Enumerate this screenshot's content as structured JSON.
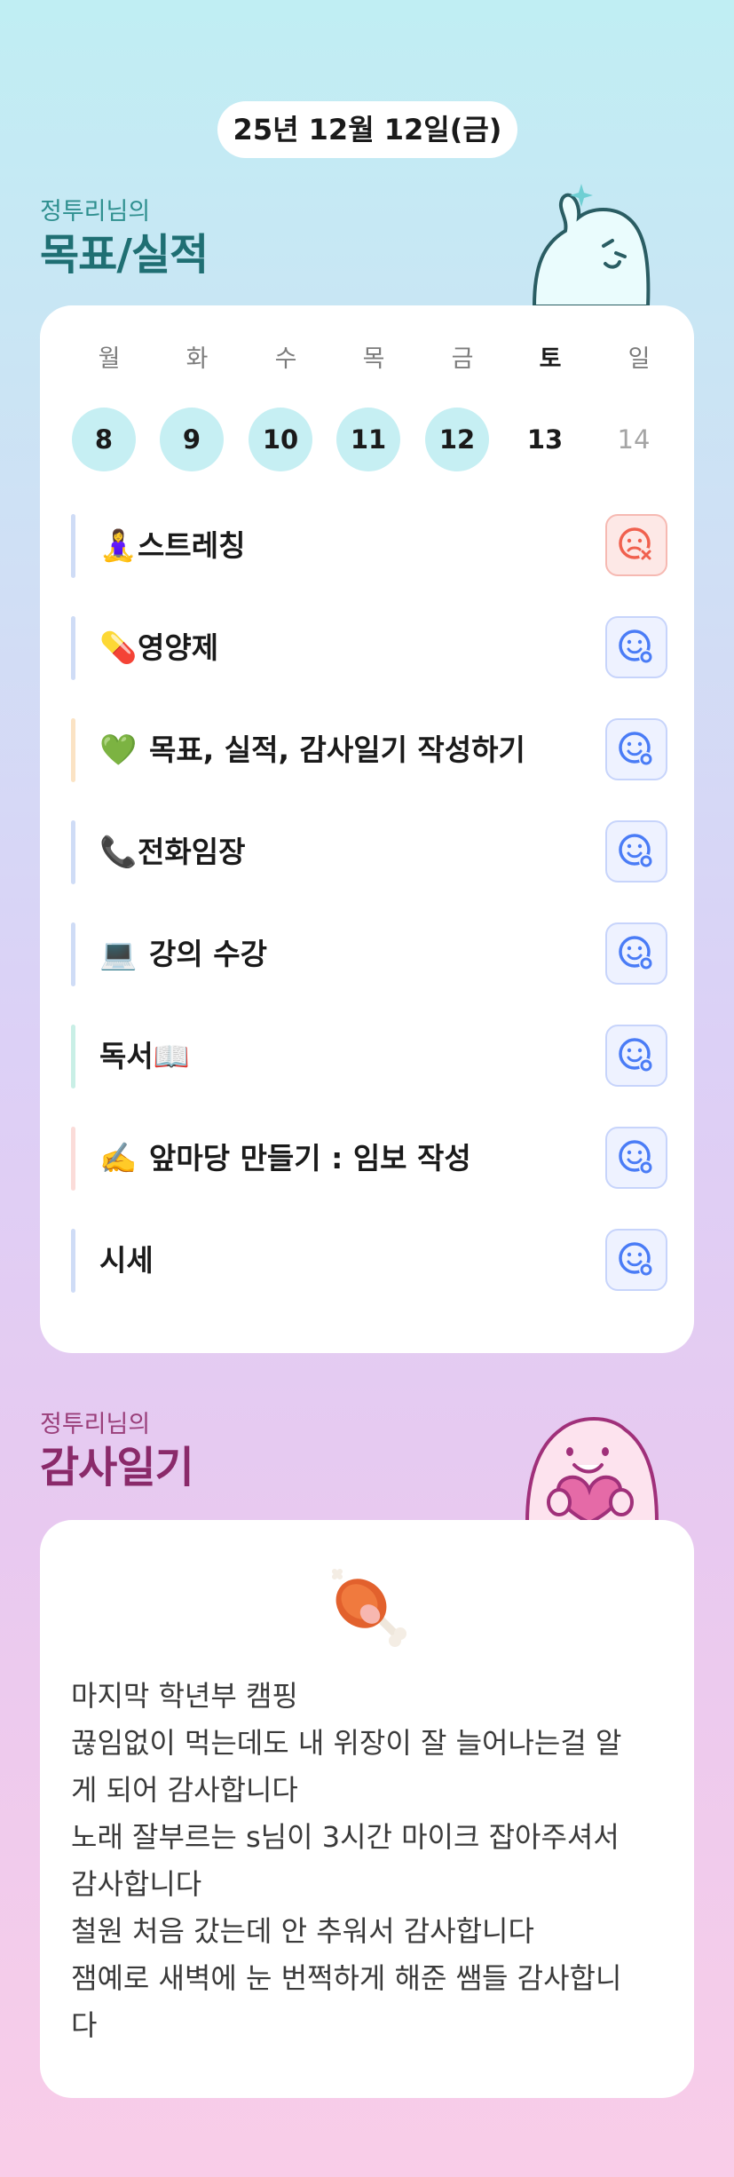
{
  "date": "25년 12월 12일(금)",
  "goals_section": {
    "subtitle": "정투리님의",
    "title": "목표/실적"
  },
  "week": {
    "days": [
      {
        "weekday": "월",
        "date": "8",
        "state": "done"
      },
      {
        "weekday": "화",
        "date": "9",
        "state": "done"
      },
      {
        "weekday": "수",
        "date": "10",
        "state": "done"
      },
      {
        "weekday": "목",
        "date": "11",
        "state": "done"
      },
      {
        "weekday": "금",
        "date": "12",
        "state": "done"
      },
      {
        "weekday": "토",
        "date": "13",
        "state": "today"
      },
      {
        "weekday": "일",
        "date": "14",
        "state": "future"
      }
    ]
  },
  "habits": [
    {
      "emoji": "🧘‍♀️",
      "label": "스트레칭",
      "status": "fail",
      "bar_color": "#cfdcf6"
    },
    {
      "emoji": "💊",
      "label": "영양제",
      "status": "done",
      "bar_color": "#cfdcf6"
    },
    {
      "emoji": "💚",
      "label": "목표, 실적, 감사일기 작성하기",
      "status": "done",
      "bar_color": "#fbe3c4"
    },
    {
      "emoji": "📞",
      "label": "전화임장",
      "status": "done",
      "bar_color": "#cfdcf6"
    },
    {
      "emoji": "💻",
      "label": "강의 수강",
      "status": "done",
      "bar_color": "#cfdcf6"
    },
    {
      "emoji": "",
      "label": "독서📖",
      "status": "done",
      "bar_color": "#c9efe6"
    },
    {
      "emoji": "✍️",
      "label": "앞마당 만들기 : 임보 작성",
      "status": "done",
      "bar_color": "#fbdcd9"
    },
    {
      "emoji": "",
      "label": "시세",
      "status": "done",
      "bar_color": "#cfdcf6"
    }
  ],
  "gratitude_section": {
    "subtitle": "정투리님의",
    "title": "감사일기"
  },
  "gratitude": {
    "icon": "meat-icon",
    "lines": [
      "마지막 학년부 캠핑",
      "끊임없이 먹는데도 내 위장이 잘 늘어나는걸 알",
      "게 되어 감사합니다",
      "노래 잘부르는 s님이 3시간 마이크 잡아주셔서",
      "감사합니다",
      "철원 처음 갔는데 안 추워서 감사합니다",
      "잼예로 새벽에 눈 번쩍하게 해준 쌤들 감사합니",
      "다"
    ]
  },
  "colors": {
    "teal_title": "#1f6f73",
    "pink_title": "#8a2a6a",
    "done_day": "#c6eff3",
    "ok_icon": "#4a7cf6",
    "fail_icon": "#f0604e"
  }
}
